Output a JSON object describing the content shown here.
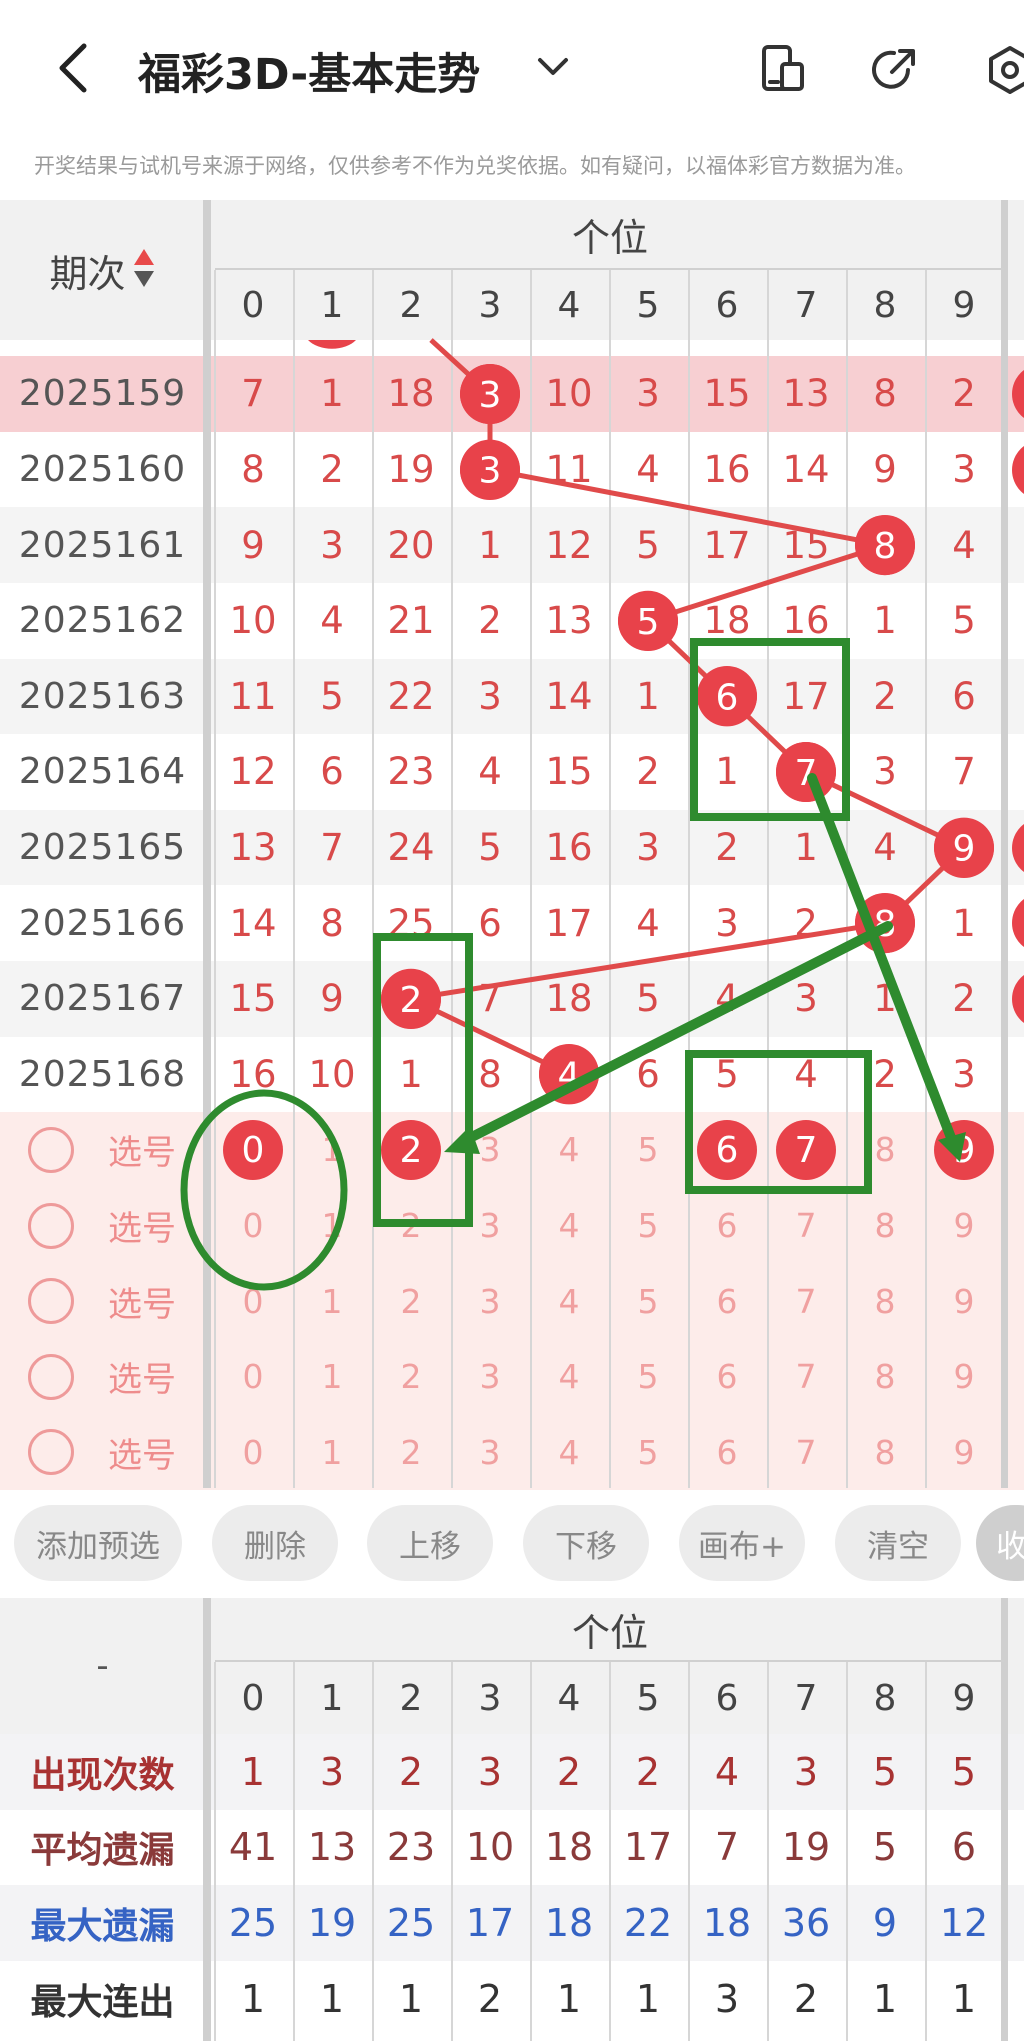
{
  "header": {
    "title": "福彩3D-基本走势",
    "notice": "开奖结果与试机号来源于网络，仅供参考不作为兑奖依据。如有疑问，以福体彩官方数据为准。"
  },
  "table": {
    "issue_header": "期次",
    "group_header": "个位",
    "digits": [
      "0",
      "1",
      "2",
      "3",
      "4",
      "5",
      "6",
      "7",
      "8",
      "9"
    ],
    "rows": [
      {
        "issue": "2025159",
        "cells": [
          "7",
          "1",
          "18",
          "3",
          "10",
          "3",
          "15",
          "13",
          "8",
          "2"
        ],
        "hit": 3
      },
      {
        "issue": "2025160",
        "cells": [
          "8",
          "2",
          "19",
          "3",
          "11",
          "4",
          "16",
          "14",
          "9",
          "3"
        ],
        "hit": 3
      },
      {
        "issue": "2025161",
        "cells": [
          "9",
          "3",
          "20",
          "1",
          "12",
          "5",
          "17",
          "15",
          "8",
          "4"
        ],
        "hit": 8
      },
      {
        "issue": "2025162",
        "cells": [
          "10",
          "4",
          "21",
          "2",
          "13",
          "5",
          "18",
          "16",
          "1",
          "5"
        ],
        "hit": 5
      },
      {
        "issue": "2025163",
        "cells": [
          "11",
          "5",
          "22",
          "3",
          "14",
          "1",
          "6",
          "17",
          "2",
          "6"
        ],
        "hit": 6
      },
      {
        "issue": "2025164",
        "cells": [
          "12",
          "6",
          "23",
          "4",
          "15",
          "2",
          "1",
          "7",
          "3",
          "7"
        ],
        "hit": 7
      },
      {
        "issue": "2025165",
        "cells": [
          "13",
          "7",
          "24",
          "5",
          "16",
          "3",
          "2",
          "1",
          "4",
          "9"
        ],
        "hit": 9
      },
      {
        "issue": "2025166",
        "cells": [
          "14",
          "8",
          "25",
          "6",
          "17",
          "4",
          "3",
          "2",
          "8",
          "1"
        ],
        "hit": 8
      },
      {
        "issue": "2025167",
        "cells": [
          "15",
          "9",
          "2",
          "7",
          "18",
          "5",
          "4",
          "3",
          "1",
          "2"
        ],
        "hit": 2
      },
      {
        "issue": "2025168",
        "cells": [
          "16",
          "10",
          "1",
          "8",
          "4",
          "6",
          "5",
          "4",
          "2",
          "3"
        ],
        "hit": 4
      }
    ],
    "select_label": "选号",
    "selection_rows": [
      {
        "selected": [
          "0",
          "2",
          "6",
          "7",
          "9"
        ]
      },
      {
        "selected": []
      },
      {
        "selected": []
      },
      {
        "selected": []
      },
      {
        "selected": []
      }
    ]
  },
  "toolbar": {
    "add_preselect": "添加预选",
    "delete": "删除",
    "move_up": "上移",
    "move_down": "下移",
    "canvas_plus": "画布+",
    "clear": "清空",
    "collapse": "收"
  },
  "stats": {
    "corner": "-",
    "group_header": "个位",
    "digits": [
      "0",
      "1",
      "2",
      "3",
      "4",
      "5",
      "6",
      "7",
      "8",
      "9"
    ],
    "rows": [
      {
        "label": "出现次数",
        "color": "#a83232",
        "values": [
          "1",
          "3",
          "2",
          "3",
          "2",
          "2",
          "4",
          "3",
          "5",
          "5"
        ]
      },
      {
        "label": "平均遗漏",
        "color": "#8a3a3a",
        "values": [
          "41",
          "13",
          "23",
          "10",
          "18",
          "17",
          "7",
          "19",
          "5",
          "6"
        ]
      },
      {
        "label": "最大遗漏",
        "color": "#3563c4",
        "values": [
          "25",
          "19",
          "25",
          "17",
          "18",
          "22",
          "18",
          "36",
          "9",
          "12"
        ]
      },
      {
        "label": "最大连出",
        "color": "#333333",
        "values": [
          "1",
          "1",
          "1",
          "2",
          "1",
          "1",
          "3",
          "2",
          "1",
          "1"
        ]
      }
    ]
  },
  "colors": {
    "ball": "#e8424a",
    "miss_text": "#d84a4a",
    "selection_bg": "#fdecea",
    "annotation_green": "#2e8b2e",
    "trend_line": "#e04a4a"
  }
}
